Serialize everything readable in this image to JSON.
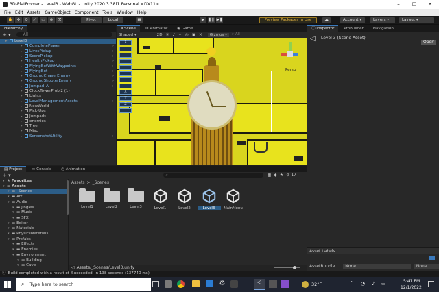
{
  "window": {
    "title": "3D-PlatFromer - Level3 - WebGL - Unity 2020.3.38f1 Personal <DX11>"
  },
  "menu": [
    "File",
    "Edit",
    "Assets",
    "GameObject",
    "Component",
    "Tools",
    "Window",
    "Help"
  ],
  "toolbar": {
    "pivot": "Pivot",
    "local": "Local",
    "preview": "Preview Packages in Use",
    "account": "Account",
    "layers": "Layers",
    "layout": "Layout"
  },
  "hierarchy": {
    "tab": "Hierarchy",
    "search_placeholder": "All",
    "items": [
      {
        "label": "Level3",
        "depth": 0,
        "type": "scene"
      },
      {
        "label": "CompletePlayer",
        "depth": 1,
        "type": "prefab"
      },
      {
        "label": "LivesPickup",
        "depth": 1,
        "type": "prefab"
      },
      {
        "label": "ScorePickup",
        "depth": 1,
        "type": "prefab"
      },
      {
        "label": "HealthPickup",
        "depth": 1,
        "type": "prefab"
      },
      {
        "label": "FlyingBotWithWaypoints",
        "depth": 1,
        "type": "prefab"
      },
      {
        "label": "FlyingBot",
        "depth": 1,
        "type": "prefab"
      },
      {
        "label": "GroundChaserEnemy",
        "depth": 1,
        "type": "prefab"
      },
      {
        "label": "GroundShooterEnemy",
        "depth": 1,
        "type": "prefab"
      },
      {
        "label": "Jumpad_A",
        "depth": 1,
        "type": "prefab"
      },
      {
        "label": "ClockTowerProbl2 (1)",
        "depth": 1,
        "type": "object"
      },
      {
        "label": "Lights",
        "depth": 1,
        "type": "object"
      },
      {
        "label": "LevelManagementAssets",
        "depth": 1,
        "type": "prefab"
      },
      {
        "label": "NewWorld",
        "depth": 1,
        "type": "object"
      },
      {
        "label": "Pick-Ups",
        "depth": 1,
        "type": "object"
      },
      {
        "label": "Jumpads",
        "depth": 1,
        "type": "object"
      },
      {
        "label": "enemies",
        "depth": 1,
        "type": "object"
      },
      {
        "label": "Tree",
        "depth": 1,
        "type": "object"
      },
      {
        "label": "Misc",
        "depth": 1,
        "type": "object"
      },
      {
        "label": "ScreenshotUtility",
        "depth": 1,
        "type": "prefab"
      }
    ]
  },
  "scene_tabs": [
    "Scene",
    "Animator",
    "Game"
  ],
  "scene_toolbar": {
    "shading": "Shaded",
    "mode": "2D",
    "gizmos": "Gizmos",
    "search": "All"
  },
  "scene_view": {
    "projection": "Persp",
    "overlay_icons": [
      "1",
      "",
      "",
      "",
      "",
      "",
      "",
      "",
      "X",
      "Y",
      "Z",
      ""
    ]
  },
  "inspector": {
    "tabs": [
      "Inspector",
      "ProBuilder",
      "Navigation"
    ],
    "title": "Level 3 (Scene Asset)",
    "open": "Open",
    "asset_labels": "Asset Labels",
    "asset_bundle": "AssetBundle",
    "bundle_value": "None",
    "variant_value": "None"
  },
  "project": {
    "tabs": [
      "Project",
      "Console",
      "Animation"
    ],
    "count": "17",
    "breadcrumb": [
      "Assets",
      ">",
      "_Scenes"
    ],
    "path": "Assets/_Scenes/Level3.unity",
    "tree": [
      {
        "label": "Favorites",
        "depth": 0,
        "bold": true
      },
      {
        "label": "Assets",
        "depth": 0,
        "bold": true
      },
      {
        "label": "_Scenes",
        "depth": 1,
        "selected": true
      },
      {
        "label": "Art",
        "depth": 1
      },
      {
        "label": "Audio",
        "depth": 1
      },
      {
        "label": "Jingles",
        "depth": 2
      },
      {
        "label": "Music",
        "depth": 2
      },
      {
        "label": "SFX",
        "depth": 2
      },
      {
        "label": "Editor",
        "depth": 1
      },
      {
        "label": "Materials",
        "depth": 1
      },
      {
        "label": "PhysicsMaterials",
        "depth": 1
      },
      {
        "label": "Prefabs",
        "depth": 1
      },
      {
        "label": "Effects",
        "depth": 2
      },
      {
        "label": "Enemies",
        "depth": 2
      },
      {
        "label": "Environment",
        "depth": 2
      },
      {
        "label": "Building",
        "depth": 3
      },
      {
        "label": "Cave",
        "depth": 3
      }
    ],
    "assets": [
      {
        "label": "Level1",
        "kind": "folder"
      },
      {
        "label": "Level2",
        "kind": "folder"
      },
      {
        "label": "Level3",
        "kind": "folder"
      },
      {
        "label": "Level1",
        "kind": "unity"
      },
      {
        "label": "Level2",
        "kind": "unity"
      },
      {
        "label": "Level3",
        "kind": "unity",
        "selected": true
      },
      {
        "label": "MainMenu",
        "kind": "unity"
      }
    ]
  },
  "status": {
    "message": "Build completed with a result of 'Succeeded' in 138 seconds (137740 ms)"
  },
  "taskbar": {
    "search": "Type here to search",
    "weather": "32°F",
    "time": "5:41 PM",
    "date": "12/1/2022"
  },
  "colors": {
    "accent": "#3a79bb",
    "scene_yellow": "#d9d51e",
    "selection": "#2c5d87"
  }
}
